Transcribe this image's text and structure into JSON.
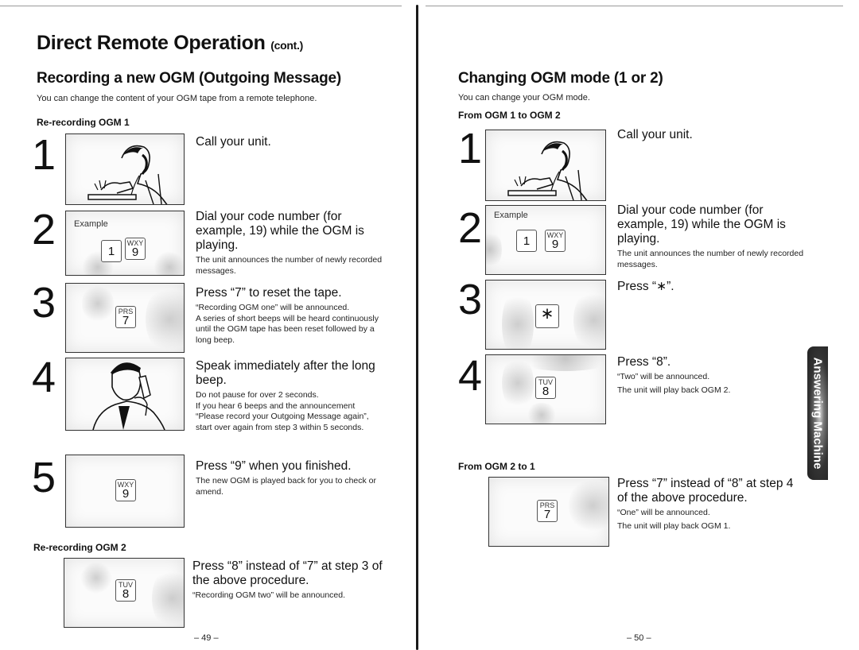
{
  "left_page": {
    "title": "Direct Remote Operation",
    "title_suffix": "(cont.)",
    "section_title": "Recording a new OGM (Outgoing Message)",
    "intro": "You can change the content of your OGM tape from  a remote telephone.",
    "subsection_1": "Re-recording OGM 1",
    "steps": [
      {
        "number": "1",
        "heading": "Call your unit.",
        "body": [],
        "illustration": "man-dialing-phone"
      },
      {
        "number": "2",
        "heading": "Dial your code number (for example, 19) while the OGM is playing.",
        "body": [
          "The unit announces the number of newly recorded messages."
        ],
        "box_label": "Example",
        "keys": [
          {
            "letters": "",
            "digit": "1"
          },
          {
            "letters": "WXY",
            "digit": "9"
          }
        ]
      },
      {
        "number": "3",
        "heading": "Press “7” to reset the tape.",
        "body": [
          "“Recording OGM one” will be announced.",
          "A series of short beeps will be heard continuously until the OGM tape has been reset followed by a long beep."
        ],
        "keys": [
          {
            "letters": "PRS",
            "digit": "7"
          }
        ]
      },
      {
        "number": "4",
        "heading": "Speak immediately after the long beep.",
        "body": [
          "Do not pause for over 2 seconds.",
          "If you hear 6 beeps and the announcement “Please record your Outgoing Message again”, start over again from step 3 within 5 seconds."
        ],
        "illustration": "man-speaking-phone"
      },
      {
        "number": "5",
        "heading": "Press “9” when you finished.",
        "body": [
          "The new OGM is played back for you to check or amend."
        ],
        "keys": [
          {
            "letters": "WXY",
            "digit": "9"
          }
        ]
      }
    ],
    "subsection_2": "Re-recording OGM 2",
    "ogm2_step": {
      "heading": "Press “8” instead of “7” at step 3 of the above procedure.",
      "body": [
        "“Recording OGM two” will be announced."
      ],
      "keys": [
        {
          "letters": "TUV",
          "digit": "8"
        }
      ]
    },
    "page_number": "– 49 –"
  },
  "right_page": {
    "section_title": "Changing OGM mode (1 or 2)",
    "intro": "You can change your OGM mode.",
    "subsection_1": "From OGM 1 to OGM 2",
    "steps": [
      {
        "number": "1",
        "heading": "Call your unit.",
        "body": [],
        "illustration": "man-dialing-phone"
      },
      {
        "number": "2",
        "heading": "Dial your code number (for example, 19) while the OGM is playing.",
        "body": [
          "The unit announces the number of newly recorded messages."
        ],
        "box_label": "Example",
        "keys": [
          {
            "letters": "",
            "digit": "1"
          },
          {
            "letters": "WXY",
            "digit": "9"
          }
        ]
      },
      {
        "number": "3",
        "heading": "Press “∗”.",
        "body": [],
        "keys": [
          {
            "letters": "",
            "digit": "∗"
          }
        ]
      },
      {
        "number": "4",
        "heading": "Press “8”.",
        "body": [
          "“Two” will be announced.",
          "The unit will play back OGM 2."
        ],
        "keys": [
          {
            "letters": "TUV",
            "digit": "8"
          }
        ]
      }
    ],
    "subsection_2": "From OGM 2 to 1",
    "ogm2to1_step": {
      "heading": "Press “7” instead of “8” at step 4 of the above procedure.",
      "body": [
        "“One” will be announced.",
        "The unit will play back OGM 1."
      ],
      "keys": [
        {
          "letters": "PRS",
          "digit": "7"
        }
      ]
    },
    "side_tab": "Answering Machine",
    "page_number": "– 50 –"
  }
}
